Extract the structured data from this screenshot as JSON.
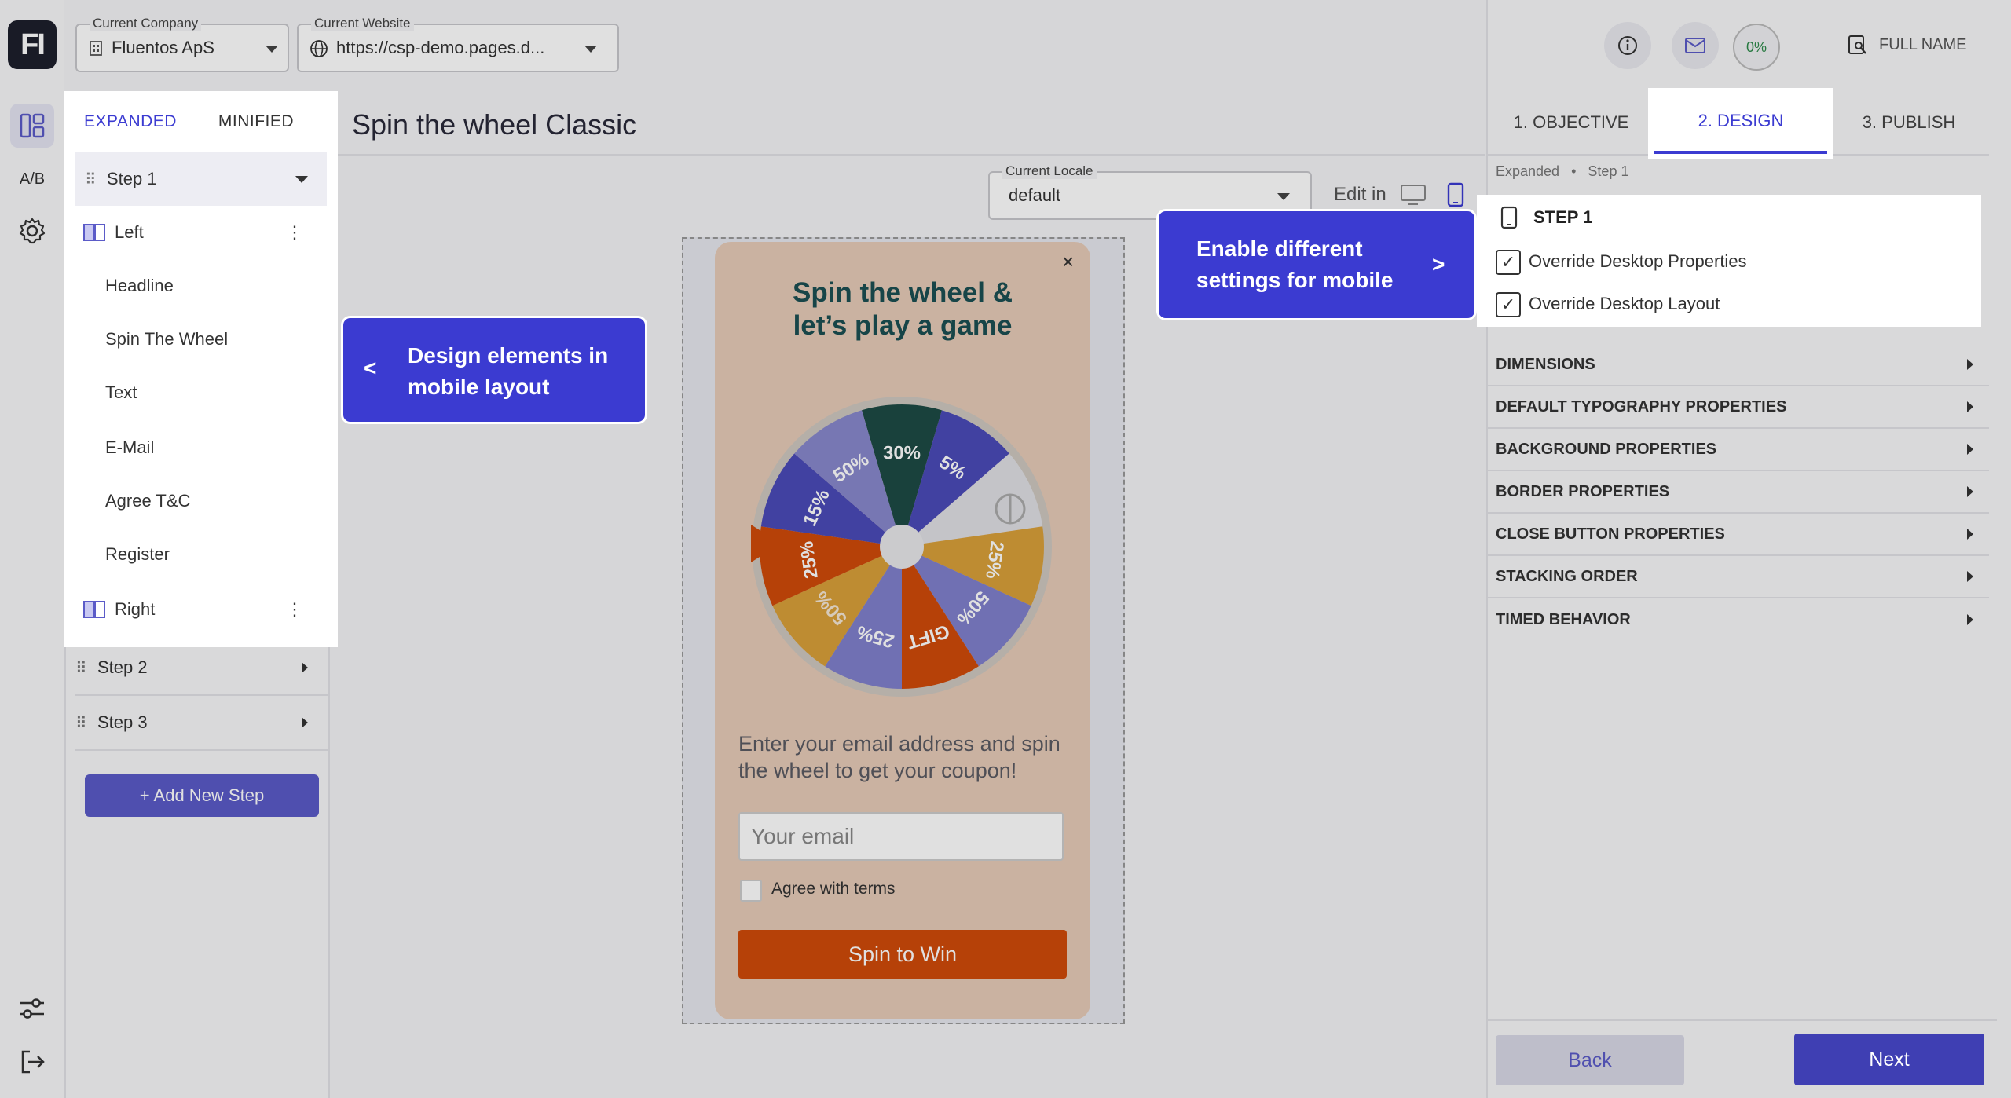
{
  "app": {
    "logo_text": "FI"
  },
  "rail": {
    "ab_label": "A/B"
  },
  "topbar": {
    "company_label": "Current Company",
    "company_value": "Fluentos ApS",
    "website_label": "Current Website",
    "website_value": "https://csp-demo.pages.d..."
  },
  "steps_panel": {
    "tabs": [
      "EXPANDED",
      "MINIFIED"
    ],
    "step1": "Step 1",
    "left": "Left",
    "items": [
      "Headline",
      "Spin The Wheel",
      "Text",
      "E-Mail",
      "Agree T&C",
      "Register"
    ],
    "right": "Right",
    "step2": "Step 2",
    "step3": "Step 3",
    "add_step": "+ Add New Step"
  },
  "center": {
    "title": "Spin the wheel Classic",
    "locale_label": "Current Locale",
    "locale_value": "default",
    "edit_in": "Edit in"
  },
  "popup": {
    "title_line1": "Spin the wheel &",
    "title_line2": "let’s play a game",
    "close": "×",
    "wheel_labels": [
      "30%",
      "5%",
      "25%",
      "50%",
      "GIFT",
      "25%",
      "50%",
      "25%",
      "15%",
      "50%"
    ],
    "text": "Enter your email address and spin the wheel to get your coupon!",
    "email_placeholder": "Your email",
    "agree": "Agree with terms",
    "button": "Spin to Win"
  },
  "callouts": {
    "left_arrow": "<",
    "left_line1": "Design elements in",
    "left_line2": "mobile layout",
    "right_line1": "Enable different",
    "right_line2": "settings for mobile",
    "right_arrow": ">"
  },
  "right_panel": {
    "progress": "0%",
    "full_name": "FULL NAME",
    "tabs": [
      "1. OBJECTIVE",
      "2. DESIGN",
      "3. PUBLISH"
    ],
    "crumbs": [
      "Expanded",
      "Step 1"
    ],
    "step_title": "STEP 1",
    "override_props": "Override Desktop Properties",
    "override_layout": "Override Desktop Layout",
    "sections": [
      "DIMENSIONS",
      "DEFAULT TYPOGRAPHY PROPERTIES",
      "BACKGROUND PROPERTIES",
      "BORDER PROPERTIES",
      "CLOSE BUTTON PROPERTIES",
      "STACKING ORDER",
      "TIMED BEHAVIOR"
    ],
    "back": "Back",
    "next": "Next"
  },
  "colors": {
    "accent": "#3b3bd1",
    "primary_button": "#3f3fb3",
    "cta": "#d04b0a",
    "popup_bg": "#e6cbb8",
    "wheel_colors": [
      "#1d4a45",
      "#4a4ab8",
      "#e0e0e4",
      "#d9a03a",
      "#8080cc",
      "#d04b0a",
      "#8080cc",
      "#d9a03a",
      "#d04b0a",
      "#4a4ab8",
      "#8888cc"
    ]
  }
}
